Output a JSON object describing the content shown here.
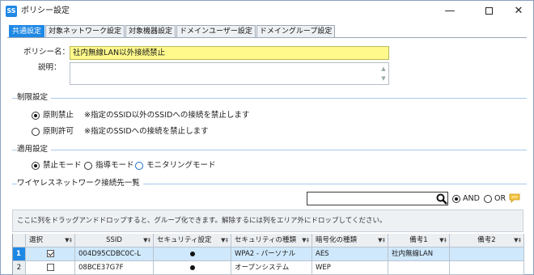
{
  "window": {
    "icon_text": "SS",
    "title": "ポリシー設定"
  },
  "tabs": [
    {
      "label": "共通設定",
      "active": true
    },
    {
      "label": "対象ネットワーク設定",
      "active": false
    },
    {
      "label": "対象機器設定",
      "active": false
    },
    {
      "label": "ドメインユーザー設定",
      "active": false
    },
    {
      "label": "ドメイングループ設定",
      "active": false
    }
  ],
  "form": {
    "policy_name_label": "ポリシー名：",
    "policy_name_value": "社内無線LAN以外接続禁止",
    "description_label": "説明：",
    "description_value": ""
  },
  "restriction": {
    "title": "制限設定",
    "options": [
      {
        "label": "原則禁止",
        "note": "※指定のSSID以外のSSIDへの接続を禁止します",
        "checked": true
      },
      {
        "label": "原則許可",
        "note": "※指定のSSIDへの接続を禁止します",
        "checked": false
      }
    ]
  },
  "apply": {
    "title": "適用設定",
    "options": [
      {
        "label": "禁止モード",
        "checked": true
      },
      {
        "label": "指導モード",
        "checked": false
      },
      {
        "label": "モニタリングモード",
        "checked": false
      }
    ]
  },
  "wireless": {
    "title": "ワイヤレスネットワーク接続先一覧",
    "search_value": "",
    "and_label": "AND",
    "or_label": "OR",
    "and_checked": true,
    "group_hint": "ここに列をドラッグアンドドロップすると、グループ化できます。解除するには列をエリア外にドロップしてください。"
  },
  "grid": {
    "columns": [
      "選択",
      "SSID",
      "セキュリティ設定",
      "セキュリティの種類",
      "暗号化の種類",
      "備考1",
      "備考2"
    ],
    "rows": [
      {
        "index": "1",
        "selected": true,
        "ssid": "004D95CDBC0C-L",
        "security_set": true,
        "security_type": "WPA2 - パーソナル",
        "encryption": "AES",
        "note1": "社内無線LAN",
        "note2": ""
      },
      {
        "index": "2",
        "selected": false,
        "ssid": "08BCE37G7F",
        "security_set": true,
        "security_type": "オープンシステム",
        "encryption": "WEP",
        "note1": "",
        "note2": ""
      }
    ]
  },
  "colors": {
    "accent": "#1e88e5",
    "highlight_input": "#fff98c",
    "selected_row": "#cfe8fb",
    "section_line": "#a8c9ec"
  }
}
